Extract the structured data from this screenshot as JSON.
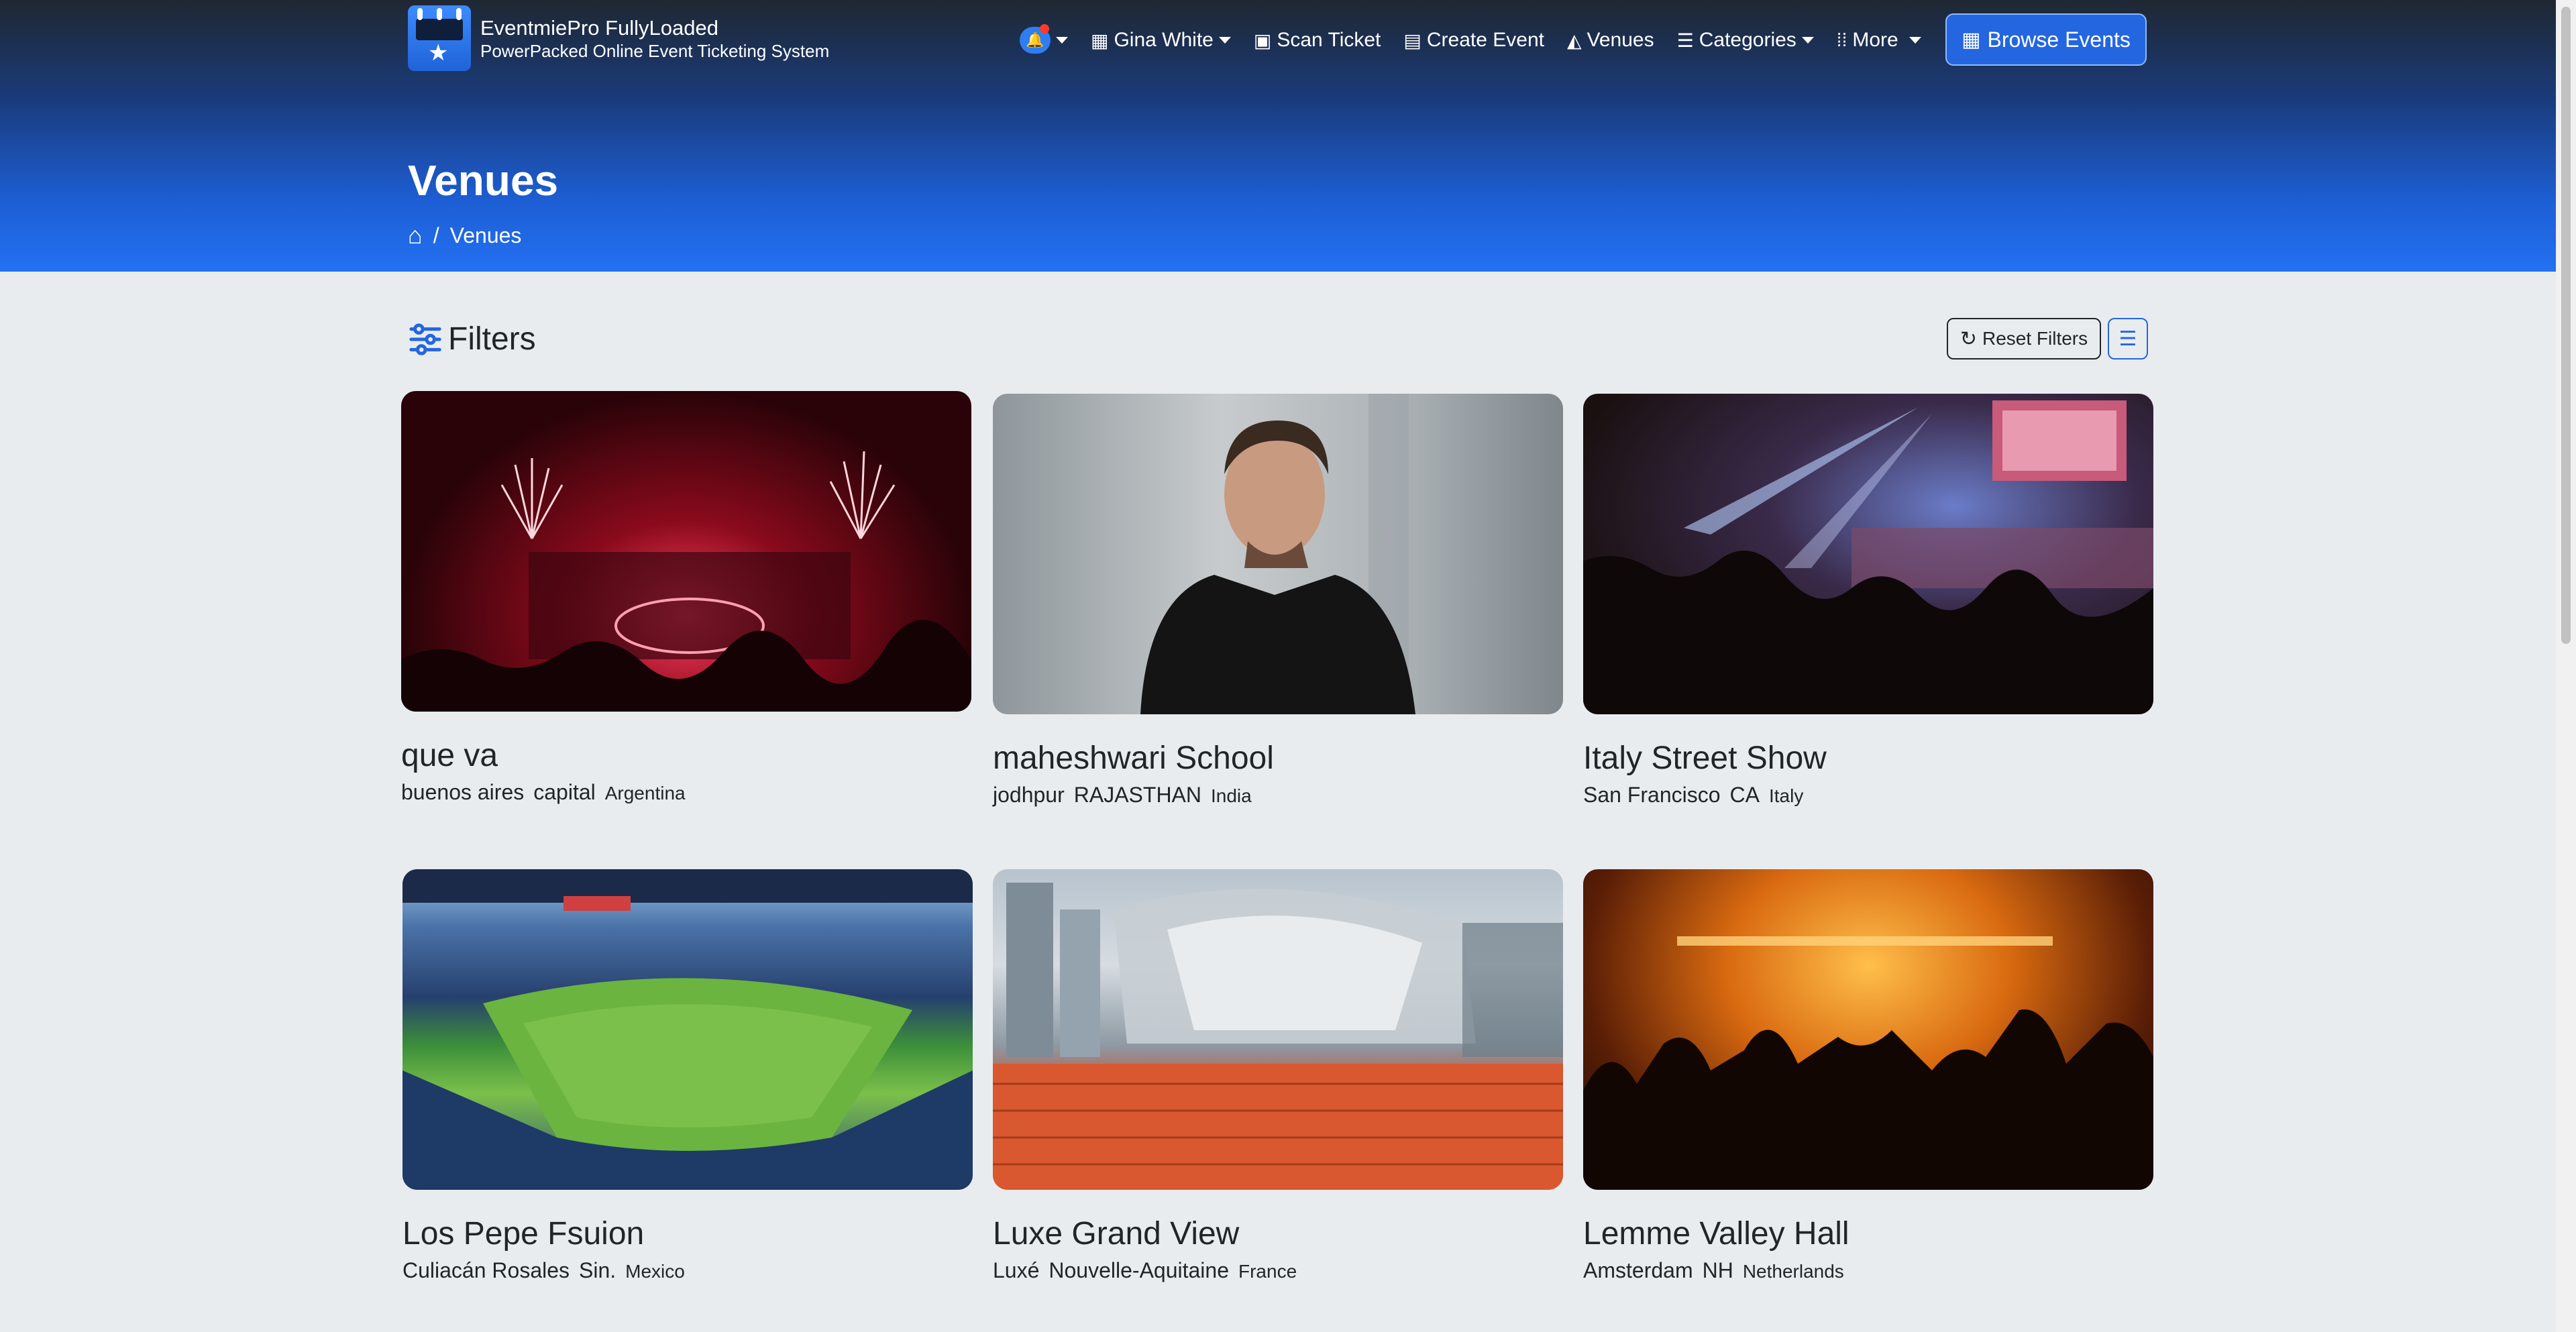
{
  "brand": {
    "title": "EventmiePro FullyLoaded",
    "subtitle": "PowerPacked Online Event Ticketing System"
  },
  "nav": {
    "user": "Gina White",
    "scan_ticket": "Scan Ticket",
    "create_event": "Create Event",
    "venues": "Venues",
    "categories": "Categories",
    "more": "More",
    "browse_events": "Browse Events"
  },
  "page": {
    "title": "Venues",
    "breadcrumb_current": "Venues"
  },
  "filters": {
    "title": "Filters",
    "reset": "Reset Filters"
  },
  "venues": [
    {
      "name": "que va",
      "city": "buenos aires",
      "state": "capital",
      "country": "Argentina",
      "image": "fireworks-concert"
    },
    {
      "name": "maheshwari School",
      "city": "jodhpur",
      "state": "RAJASTHAN",
      "country": "India",
      "image": "man-portrait"
    },
    {
      "name": "Italy Street Show",
      "city": "San Francisco",
      "state": "CA",
      "country": "Italy",
      "image": "stage-show"
    },
    {
      "name": "Los Pepe Fsuion",
      "city": "Culiacán Rosales",
      "state": "Sin.",
      "country": "Mexico",
      "image": "football-stadium"
    },
    {
      "name": "Luxe Grand View",
      "city": "Luxé",
      "state": "Nouvelle-Aquitaine",
      "country": "France",
      "image": "amphitheater"
    },
    {
      "name": "Lemme Valley Hall",
      "city": "Amsterdam",
      "state": "NH",
      "country": "Netherlands",
      "image": "concert-crowd"
    }
  ],
  "colors": {
    "accent": "#2466e0",
    "page_bg": "#e9ecef",
    "notification_dot": "#ff3b30"
  }
}
